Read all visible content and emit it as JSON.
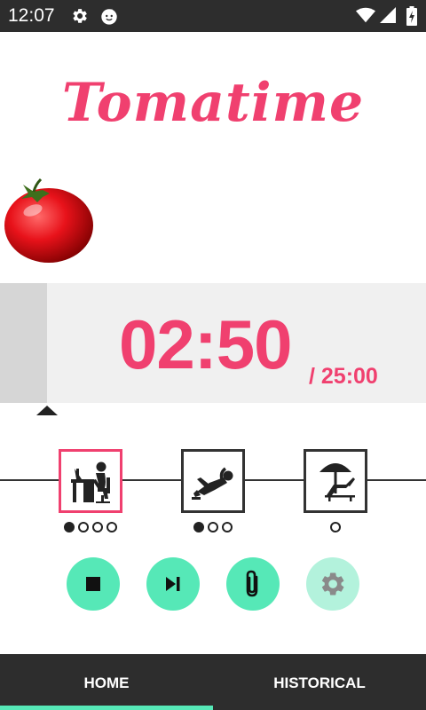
{
  "status_bar": {
    "time": "12:07",
    "icons": [
      "gear-icon",
      "tomato-app-icon",
      "wifi-icon",
      "cell-signal-icon",
      "battery-charging-icon"
    ]
  },
  "app": {
    "title": "Tomatime"
  },
  "timer": {
    "current": "02:50",
    "total": "/ 25:00",
    "progress": 0.11
  },
  "phases": [
    {
      "name": "work",
      "icon": "desk-worker-icon",
      "active": true,
      "dots": [
        true,
        false,
        false,
        false
      ]
    },
    {
      "name": "short-break",
      "icon": "relaxing-person-icon",
      "active": false,
      "dots": [
        true,
        false,
        false
      ]
    },
    {
      "name": "long-break",
      "icon": "beach-umbrella-icon",
      "active": false,
      "dots": [
        false
      ]
    }
  ],
  "actions": [
    {
      "name": "stop",
      "icon": "stop-icon",
      "enabled": true
    },
    {
      "name": "skip",
      "icon": "skip-next-icon",
      "enabled": true
    },
    {
      "name": "attach",
      "icon": "paperclip-icon",
      "enabled": true
    },
    {
      "name": "settings",
      "icon": "gear-icon",
      "enabled": false
    }
  ],
  "nav": {
    "tabs": [
      "HOME",
      "HISTORICAL"
    ],
    "selected": 0
  },
  "colors": {
    "accent": "#f0406f",
    "mint": "#56e8b7",
    "mint_disabled": "#b3f2dc",
    "dark": "#2d2d2d"
  }
}
